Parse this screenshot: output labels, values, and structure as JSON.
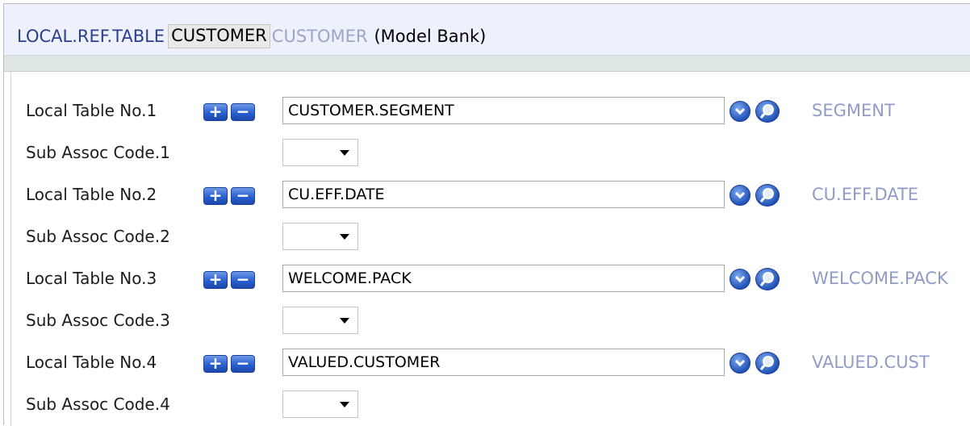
{
  "header": {
    "application": "LOCAL.REF.TABLE",
    "record_id": "CUSTOMER",
    "record_description": "CUSTOMER",
    "company": "(Model Bank)"
  },
  "colors": {
    "header_bg": "#eef1fb",
    "app_title": "#2b3f8c",
    "enrichment_text": "#8f9dc4",
    "button_blue": "#2a5fcf",
    "strip_bg": "#dfe7e2"
  },
  "icons": {
    "expand": "plus-icon",
    "collapse": "minus-icon",
    "dropdown": "chevron-down-icon",
    "lookup": "magnifier-icon"
  },
  "buttons": {
    "plus": "+",
    "minus": "−"
  },
  "rows": [
    {
      "table_label": "Local Table No.1",
      "table_value": "CUSTOMER.SEGMENT",
      "enrichment": "SEGMENT",
      "sub_label": "Sub Assoc Code.1",
      "sub_value": ""
    },
    {
      "table_label": "Local Table No.2",
      "table_value": "CU.EFF.DATE",
      "enrichment": "CU.EFF.DATE",
      "sub_label": "Sub Assoc Code.2",
      "sub_value": ""
    },
    {
      "table_label": "Local Table No.3",
      "table_value": "WELCOME.PACK",
      "enrichment": "WELCOME.PACK",
      "sub_label": "Sub Assoc Code.3",
      "sub_value": ""
    },
    {
      "table_label": "Local Table No.4",
      "table_value": "VALUED.CUSTOMER",
      "enrichment": "VALUED.CUST",
      "sub_label": "Sub Assoc Code.4",
      "sub_value": ""
    }
  ]
}
